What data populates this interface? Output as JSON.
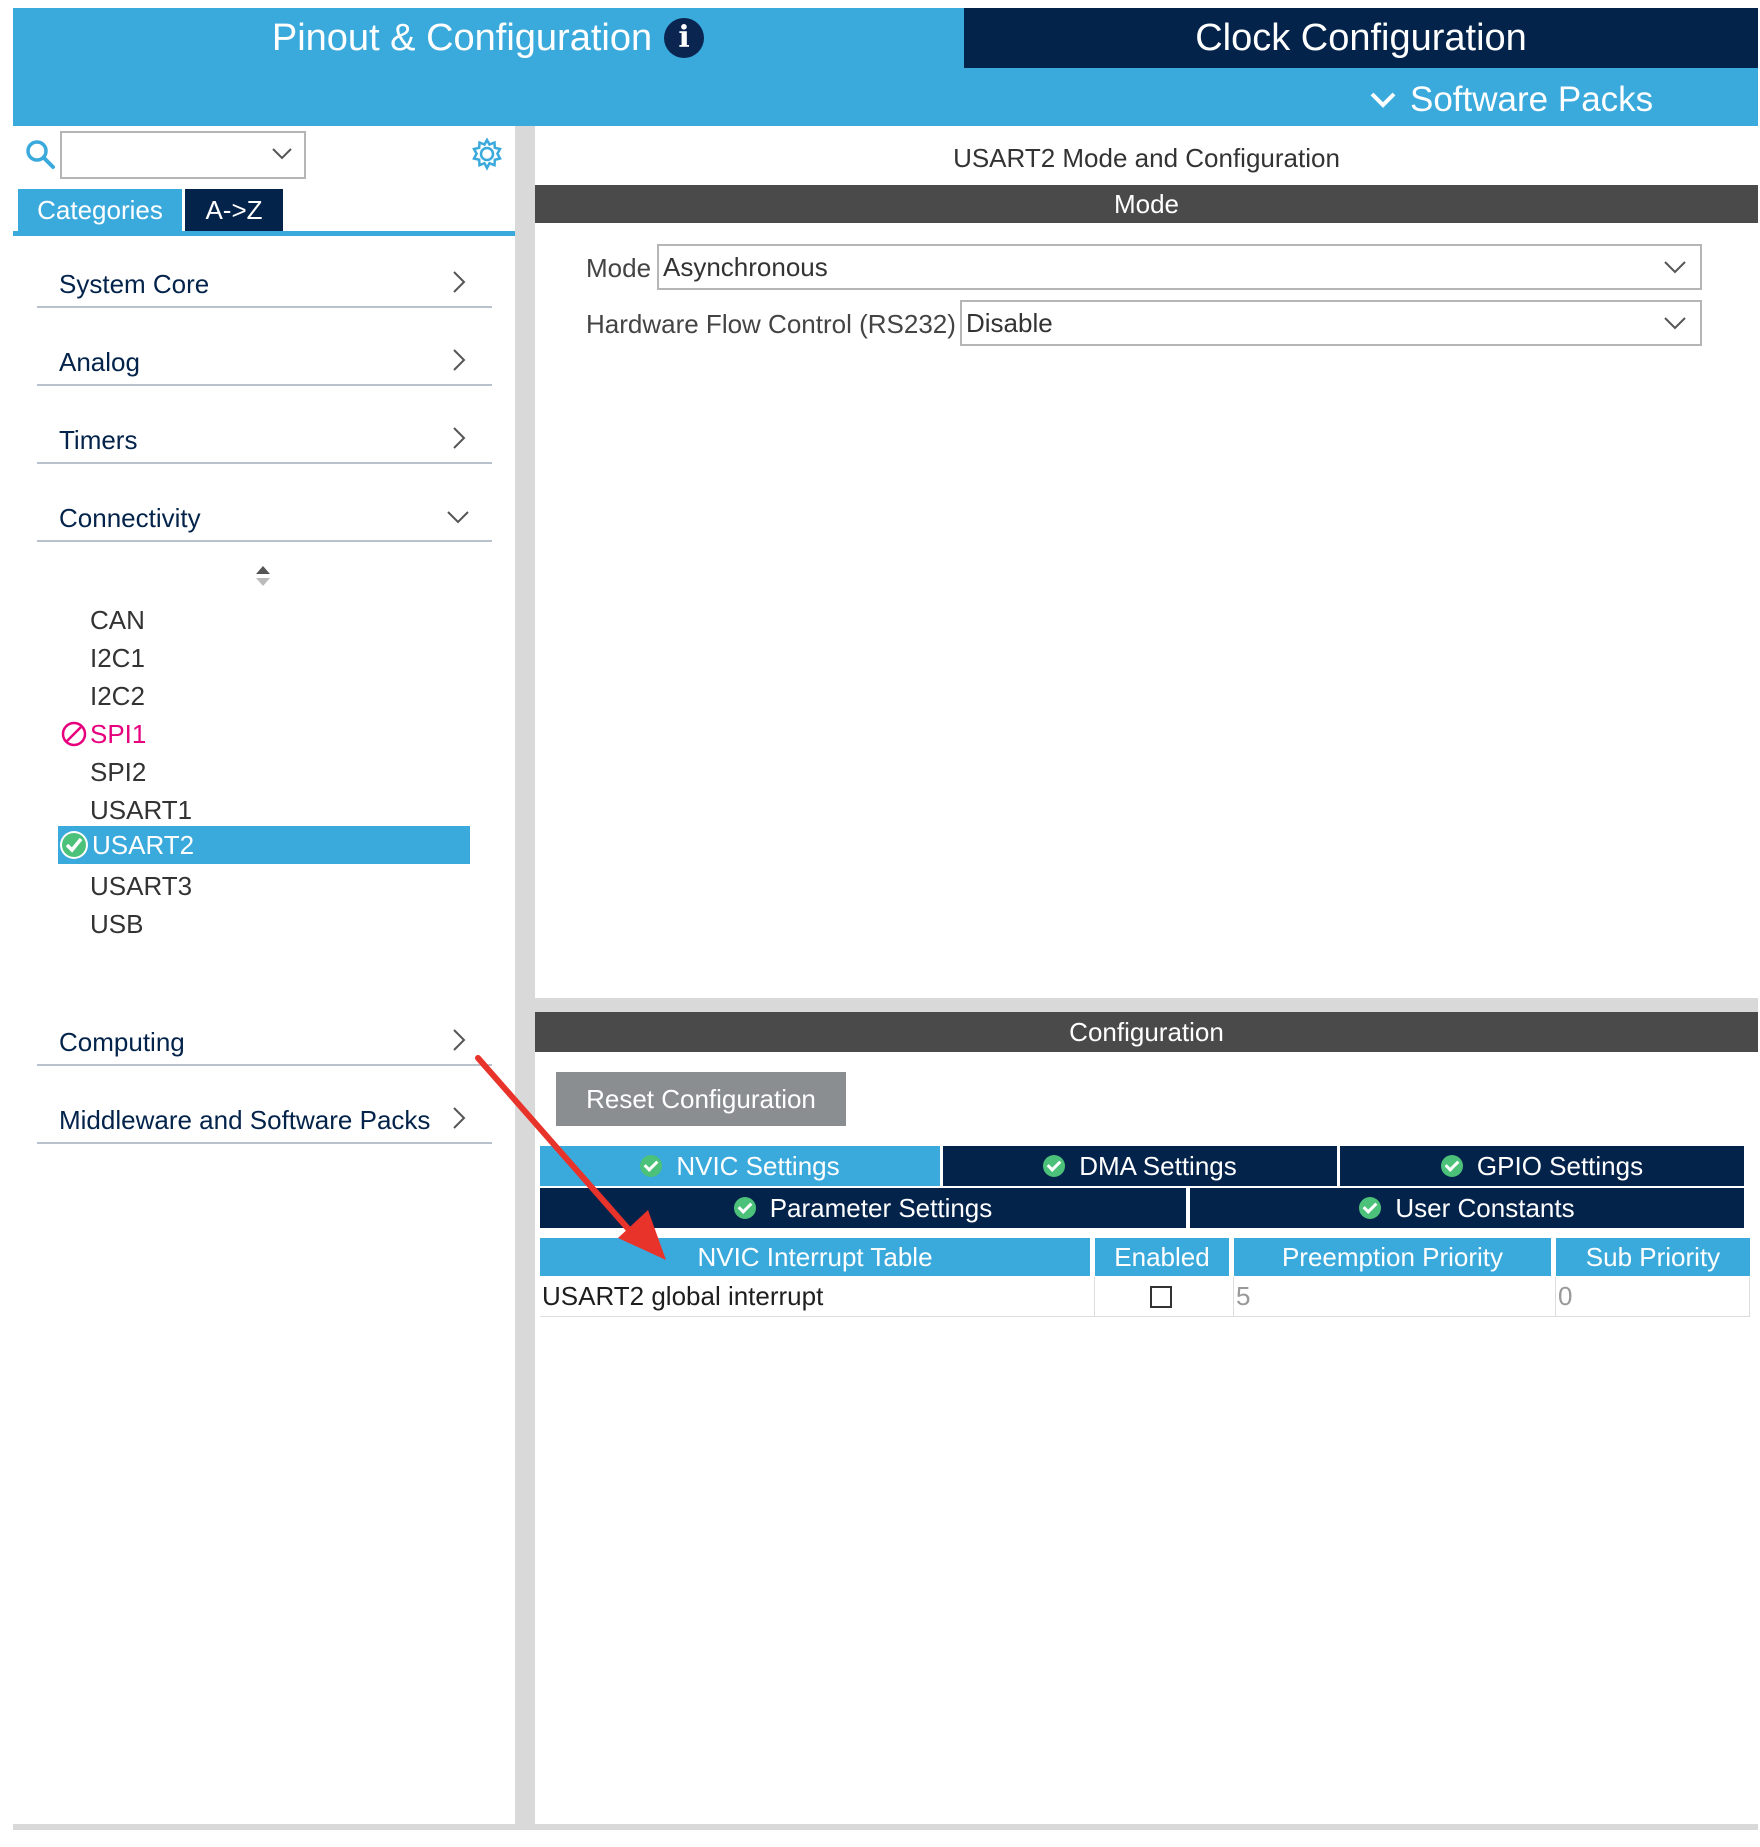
{
  "header": {
    "tab_pinout": "Pinout & Configuration",
    "tab_clock": "Clock Configuration",
    "software_packs": "Software Packs"
  },
  "colors": {
    "accent_blue": "#3aa9dc",
    "dark_navy": "#03234b",
    "section_header": "#4a4a4a",
    "disabled_pink": "#e6007e",
    "ok_green": "#4cc17a",
    "annotation_red": "#e8332b"
  },
  "left": {
    "tabs": [
      "Categories",
      "A->Z"
    ],
    "categories": [
      {
        "label": "System Core"
      },
      {
        "label": "Analog"
      },
      {
        "label": "Timers"
      },
      {
        "label": "Connectivity"
      },
      {
        "label": "Computing"
      },
      {
        "label": "Middleware and Software Packs"
      }
    ],
    "connectivity_items": [
      "CAN",
      "I2C1",
      "I2C2",
      "SPI1",
      "SPI2",
      "USART1",
      "USART2",
      "USART3",
      "USB"
    ],
    "selected_item": "USART2",
    "disabled_item": "SPI1"
  },
  "mode": {
    "title": "USART2 Mode and Configuration",
    "header": "Mode",
    "mode_label": "Mode",
    "mode_value": "Asynchronous",
    "flow_label": "Hardware Flow Control (RS232)",
    "flow_value": "Disable"
  },
  "config": {
    "header": "Configuration",
    "reset_button": "Reset Configuration",
    "tabs_row1": [
      "NVIC Settings",
      "DMA Settings",
      "GPIO Settings"
    ],
    "tabs_row2": [
      "Parameter Settings",
      "User Constants"
    ],
    "active_tab": "NVIC Settings",
    "table": {
      "columns": [
        "NVIC Interrupt Table",
        "Enabled",
        "Preemption Priority",
        "Sub Priority"
      ],
      "rows": [
        {
          "name": "USART2 global interrupt",
          "enabled": false,
          "preemption": "5",
          "sub": "0"
        }
      ]
    }
  }
}
